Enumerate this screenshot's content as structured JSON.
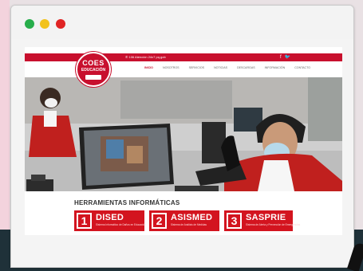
{
  "window": {
    "controls": [
      "close",
      "minimize",
      "maximize"
    ]
  },
  "topbar": {
    "phone": "✆ 106 Atención 24x7 pq.gob",
    "social_icons": [
      "facebook-icon",
      "twitter-icon"
    ]
  },
  "logo": {
    "line1": "COES",
    "line2": "EDUCACIÓN"
  },
  "nav": [
    "INICIO",
    "NOSOTROS",
    "SERVICIOS",
    "NOTICIAS",
    "DESCARGAS",
    "INFORMACIÓN",
    "CONTACTO"
  ],
  "section_title": "HERRAMIENTAS INFORMÁTICAS",
  "tools": [
    {
      "number": "1",
      "name": "DISED",
      "desc": "Sistema Informático de Daños en Educación"
    },
    {
      "number": "2",
      "name": "ASISMED",
      "desc": "Sistema de Análisis de Medidas"
    },
    {
      "number": "3",
      "name": "SASPRIE",
      "desc": "Sistema de Alerta y Prevención de Emergencias"
    }
  ],
  "colors": {
    "brand_red": "#c8102e",
    "dark_band": "#1f3139"
  }
}
